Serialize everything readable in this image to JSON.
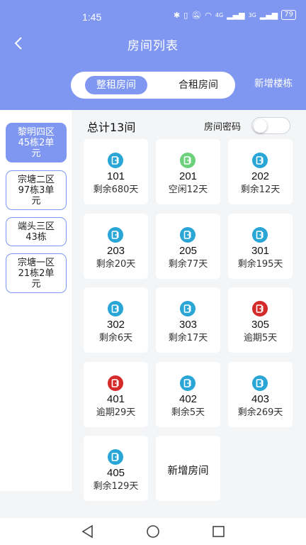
{
  "status_bar": {
    "time": "1:45",
    "signal_4g": "4G",
    "signal_3g": "3G",
    "battery": "79"
  },
  "nav": {
    "title": "房间列表",
    "back_icon": "chevron-left-icon"
  },
  "tabs": {
    "whole": "整租房间",
    "shared": "合租房间",
    "add_building": "新增楼栋"
  },
  "sidebar": {
    "items": [
      {
        "label": "黎明四区\n45栋2单\n元",
        "active": true
      },
      {
        "label": "宗塘二区\n97栋3单\n元",
        "active": false
      },
      {
        "label": "端头三区\n43栋",
        "active": false
      },
      {
        "label": "宗塘一区\n21栋2单\n元",
        "active": false
      }
    ]
  },
  "content": {
    "total": "总计13间",
    "password_label": "房间密码",
    "password_toggle_on": false,
    "add_room": "新增房间"
  },
  "colors": {
    "occupied": "#2aa6d6",
    "vacant": "#6cd17a",
    "overdue": "#d42a2a",
    "accent": "#7f97f0"
  },
  "rooms": [
    {
      "number": "101",
      "status": "剩余680天",
      "state": "occupied"
    },
    {
      "number": "201",
      "status": "空闲12天",
      "state": "vacant"
    },
    {
      "number": "202",
      "status": "剩余12天",
      "state": "occupied"
    },
    {
      "number": "203",
      "status": "剩余20天",
      "state": "occupied"
    },
    {
      "number": "205",
      "status": "剩余77天",
      "state": "occupied"
    },
    {
      "number": "301",
      "status": "剩余195天",
      "state": "occupied"
    },
    {
      "number": "302",
      "status": "剩余6天",
      "state": "occupied"
    },
    {
      "number": "303",
      "status": "剩余17天",
      "state": "occupied"
    },
    {
      "number": "305",
      "status": "逾期5天",
      "state": "overdue"
    },
    {
      "number": "401",
      "status": "逾期29天",
      "state": "overdue"
    },
    {
      "number": "402",
      "status": "剩余5天",
      "state": "occupied"
    },
    {
      "number": "403",
      "status": "剩余269天",
      "state": "occupied"
    },
    {
      "number": "405",
      "status": "剩余129天",
      "state": "occupied"
    }
  ],
  "system_nav": {
    "back": "triangle-back-icon",
    "home": "circle-home-icon",
    "recents": "square-recents-icon"
  }
}
